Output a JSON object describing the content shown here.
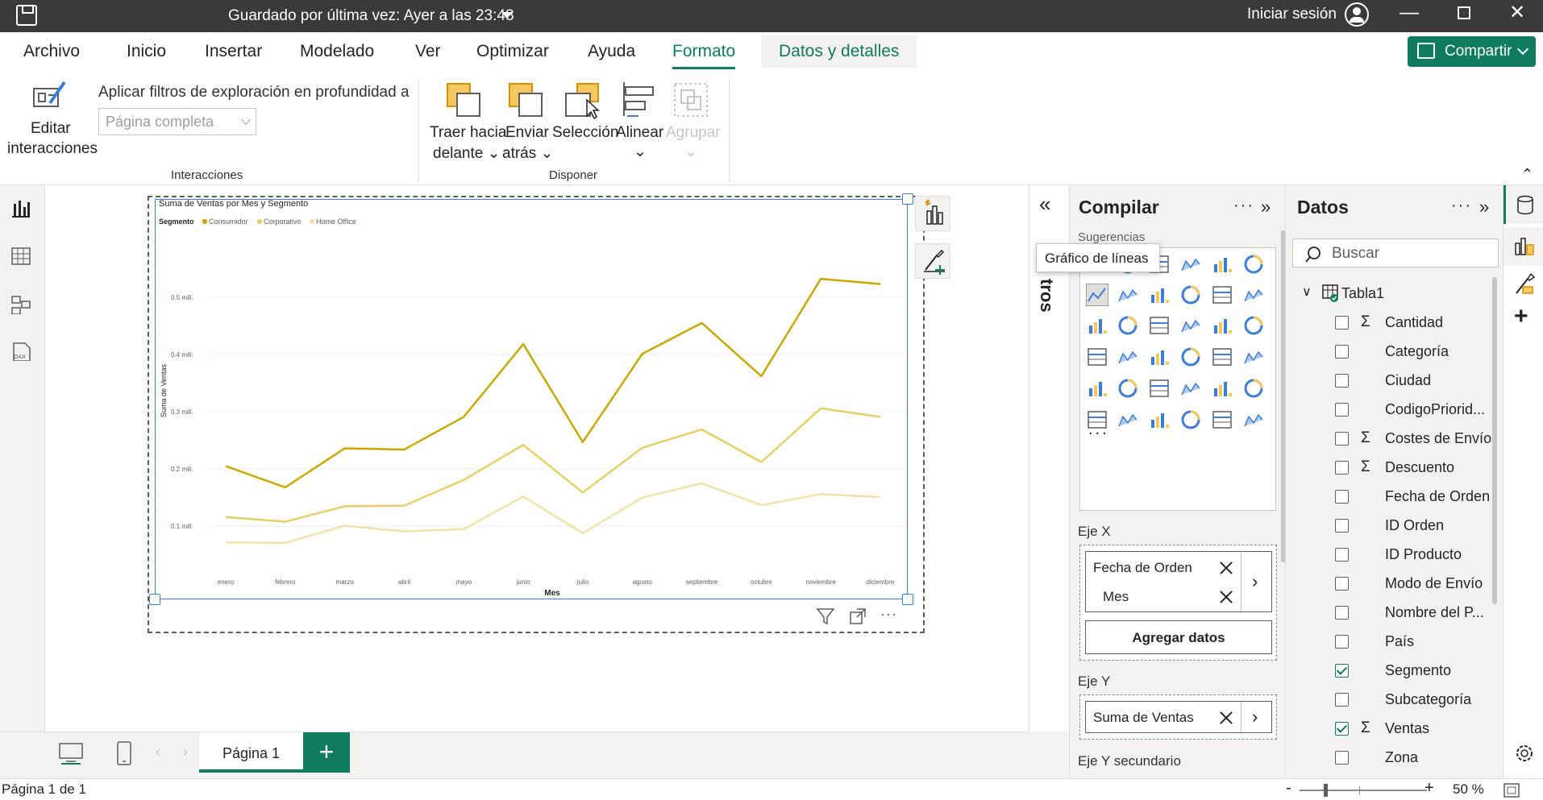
{
  "titlebar": {
    "saved_text": "Guardado por última vez: Ayer a las 23:48",
    "signin": "Iniciar sesión"
  },
  "ribbon": {
    "tabs": [
      "Archivo",
      "Inicio",
      "Insertar",
      "Modelado",
      "Ver",
      "Optimizar",
      "Ayuda",
      "Formato",
      "Datos y detalles"
    ],
    "active_tab": "Formato",
    "share_label": "Compartir",
    "edit_interactions_1": "Editar",
    "edit_interactions_2": "interacciones",
    "drill_filter_label": "Aplicar filtros de exploración en profundidad a",
    "drill_filter_value": "Página completa",
    "group_interacciones": "Interacciones",
    "bring_front_1": "Traer hacia",
    "bring_front_2": "delante",
    "send_back_1": "Enviar",
    "send_back_2": "atrás",
    "selection": "Selección",
    "align": "Alinear",
    "group": "Agrupar",
    "group_disponer": "Disponer"
  },
  "chart_data": {
    "type": "line",
    "title": "Suma de Ventas por Mes y Segmento",
    "legend_title": "Segmento",
    "xlabel": "Mes",
    "ylabel": "Suma de Ventas",
    "categories": [
      "enero",
      "febrero",
      "marzo",
      "abril",
      "mayo",
      "junio",
      "julio",
      "agosto",
      "septiembre",
      "octubre",
      "noviembre",
      "diciembre"
    ],
    "y_ticks": [
      "0.1 mill.",
      "0.2 mill.",
      "0.3 mill.",
      "0.4 mill.",
      "0.5 mill."
    ],
    "y_tick_values": [
      0.1,
      0.2,
      0.3,
      0.4,
      0.5
    ],
    "ylim": [
      0.03,
      0.58
    ],
    "grid": true,
    "legend_position": "top-left",
    "series": [
      {
        "name": "Consumidor",
        "color": "#c9a800",
        "values": [
          0.205,
          0.168,
          0.236,
          0.234,
          0.291,
          0.418,
          0.247,
          0.401,
          0.455,
          0.362,
          0.532,
          0.523
        ]
      },
      {
        "name": "Corporativo",
        "color": "#e6cf66",
        "values": [
          0.116,
          0.108,
          0.135,
          0.136,
          0.181,
          0.242,
          0.159,
          0.237,
          0.269,
          0.212,
          0.306,
          0.291
        ]
      },
      {
        "name": "Home Office",
        "color": "#f2e2a8",
        "values": [
          0.072,
          0.071,
          0.101,
          0.091,
          0.095,
          0.152,
          0.088,
          0.15,
          0.175,
          0.137,
          0.156,
          0.151
        ]
      }
    ]
  },
  "bottombar": {
    "page_tab": "Página 1",
    "add_page": "+"
  },
  "status": {
    "page_count": "Página 1 de 1",
    "zoom": "50 %"
  },
  "tooltip": "Gráfico de líneas",
  "collapsed_pane_label": "tros",
  "build": {
    "title": "Compilar",
    "suggestions": "Sugerencias",
    "more": "...",
    "x_axis_title": "Eje X",
    "x_fields": [
      "Fecha de Orden",
      "Mes"
    ],
    "add_data": "Agregar datos",
    "y_axis_title": "Eje Y",
    "y_fields": [
      "Suma de Ventas"
    ],
    "y2_axis_title": "Eje Y secundario"
  },
  "data": {
    "title": "Datos",
    "search_placeholder": "Buscar",
    "table_name": "Tabla1",
    "fields": [
      {
        "name": "Cantidad",
        "sigma": true,
        "checked": false
      },
      {
        "name": "Categoría",
        "sigma": false,
        "checked": false
      },
      {
        "name": "Ciudad",
        "sigma": false,
        "checked": false
      },
      {
        "name": "CodigoPriorid...",
        "sigma": false,
        "checked": false
      },
      {
        "name": "Costes de Envío",
        "sigma": true,
        "checked": false
      },
      {
        "name": "Descuento",
        "sigma": true,
        "checked": false
      },
      {
        "name": "Fecha de Orden",
        "sigma": false,
        "checked": false
      },
      {
        "name": "ID Orden",
        "sigma": false,
        "checked": false
      },
      {
        "name": "ID Producto",
        "sigma": false,
        "checked": false
      },
      {
        "name": "Modo de Envío",
        "sigma": false,
        "checked": false
      },
      {
        "name": "Nombre del P...",
        "sigma": false,
        "checked": false
      },
      {
        "name": "País",
        "sigma": false,
        "checked": false
      },
      {
        "name": "Segmento",
        "sigma": false,
        "checked": true
      },
      {
        "name": "Subcategoría",
        "sigma": false,
        "checked": false
      },
      {
        "name": "Ventas",
        "sigma": true,
        "checked": true
      },
      {
        "name": "Zona",
        "sigma": false,
        "checked": false
      }
    ]
  },
  "colors": {
    "accent": "#0f7b5f",
    "titlebar": "#3b3a39",
    "selection": "#3b7dd8"
  }
}
